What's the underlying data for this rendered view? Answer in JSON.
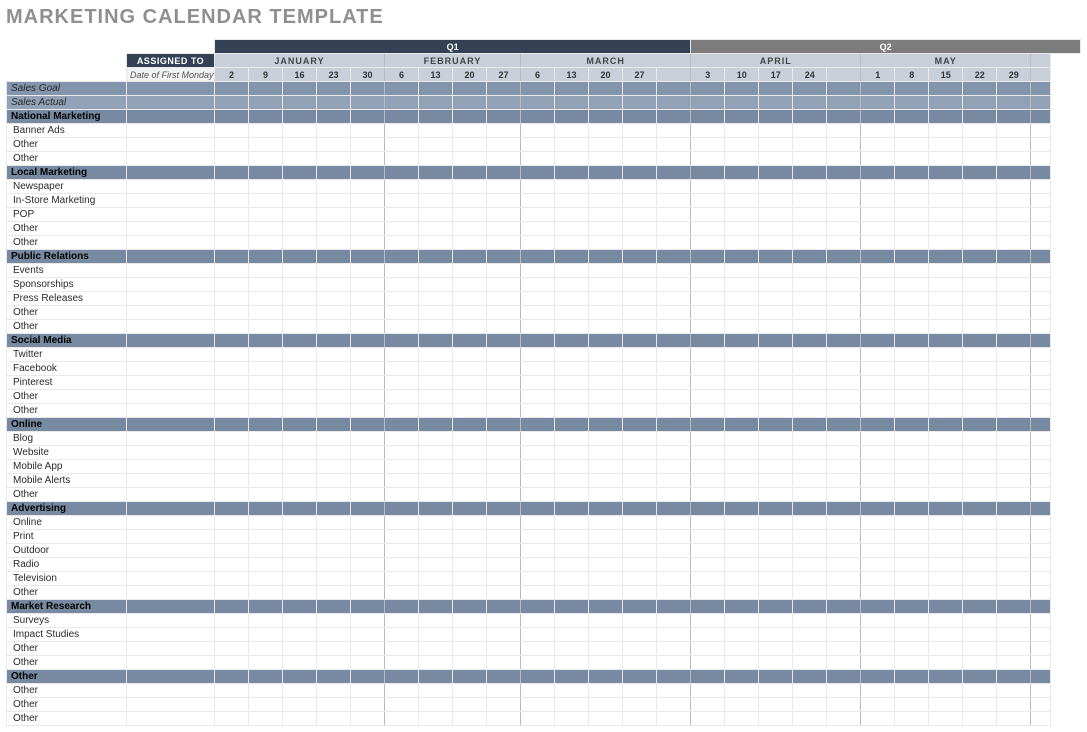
{
  "title": "MARKETING CALENDAR TEMPLATE",
  "headers": {
    "assigned_to": "ASSIGNED TO",
    "date_label": "Date of First Monday",
    "quarters": [
      {
        "label": "Q1",
        "span": 14
      },
      {
        "label": "Q2",
        "span": 11
      }
    ],
    "months": [
      {
        "label": "JANUARY",
        "weeks": [
          "2",
          "9",
          "16",
          "23",
          "30"
        ]
      },
      {
        "label": "FEBRUARY",
        "weeks": [
          "6",
          "13",
          "20",
          "27"
        ]
      },
      {
        "label": "MARCH",
        "weeks": [
          "6",
          "13",
          "20",
          "27",
          ""
        ]
      },
      {
        "label": "APRIL",
        "weeks": [
          "3",
          "10",
          "17",
          "24",
          ""
        ]
      },
      {
        "label": "MAY",
        "weeks": [
          "1",
          "8",
          "15",
          "22",
          "29"
        ]
      }
    ]
  },
  "sales_rows": [
    {
      "label": "Sales Goal"
    },
    {
      "label": "Sales Actual"
    }
  ],
  "sections": [
    {
      "title": "National Marketing",
      "items": [
        "Banner Ads",
        "Other",
        "Other"
      ]
    },
    {
      "title": "Local Marketing",
      "items": [
        "Newspaper",
        "In-Store Marketing",
        "POP",
        "Other",
        "Other"
      ]
    },
    {
      "title": "Public Relations",
      "items": [
        "Events",
        "Sponsorships",
        "Press Releases",
        "Other",
        "Other"
      ]
    },
    {
      "title": "Social Media",
      "items": [
        "Twitter",
        "Facebook",
        "Pinterest",
        "Other",
        "Other"
      ]
    },
    {
      "title": "Online",
      "items": [
        "Blog",
        "Website",
        "Mobile App",
        "Mobile Alerts",
        "Other"
      ]
    },
    {
      "title": "Advertising",
      "items": [
        "Online",
        "Print",
        "Outdoor",
        "Radio",
        "Television",
        "Other"
      ]
    },
    {
      "title": "Market Research",
      "items": [
        "Surveys",
        "Impact Studies",
        "Other",
        "Other"
      ]
    },
    {
      "title": "Other",
      "items": [
        "Other",
        "Other",
        "Other"
      ]
    }
  ]
}
